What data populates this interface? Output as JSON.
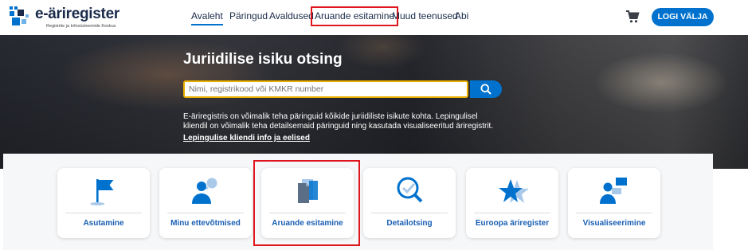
{
  "header": {
    "logo_title": "e-äriregister",
    "logo_subtitle": "Registrite ja Infosüsteemide Keskus",
    "nav": [
      {
        "label": "Avaleht",
        "active": true
      },
      {
        "label": "Päringud"
      },
      {
        "label": "Avaldused"
      },
      {
        "label": "Aruande esitamine",
        "highlighted": true
      },
      {
        "label": "Muud teenused"
      },
      {
        "label": "Abi"
      }
    ],
    "cart_icon": "shopping-cart-icon",
    "logout_label": "LOGI VÄLJA"
  },
  "hero": {
    "title": "Juriidilise isiku otsing",
    "search_placeholder": "Nimi, registrikood või KMKR number",
    "search_icon": "search-icon",
    "description": "E-äriregistris on võimalik teha päringuid kõikide juriidiliste isikute kohta. Lepingulisel kliendil on võimalik teha detailsemaid päringuid ning kasutada visualiseeritud äriregistrit.",
    "link": "Lepingulise kliendi info ja eelised"
  },
  "cards": [
    {
      "label": "Asutamine",
      "icon": "flag-icon"
    },
    {
      "label": "Minu ettevõtmised",
      "icon": "person-chat-icon"
    },
    {
      "label": "Aruande esitamine",
      "icon": "documents-icon",
      "highlighted": true
    },
    {
      "label": "Detailotsing",
      "icon": "magnifier-check-icon"
    },
    {
      "label": "Euroopa äriregister",
      "icon": "star-icon"
    },
    {
      "label": "Visualiseerimine",
      "icon": "person-chart-icon"
    }
  ],
  "colors": {
    "accent": "#0072ce",
    "highlight": "#e0161e",
    "search_border": "#e9b000"
  }
}
